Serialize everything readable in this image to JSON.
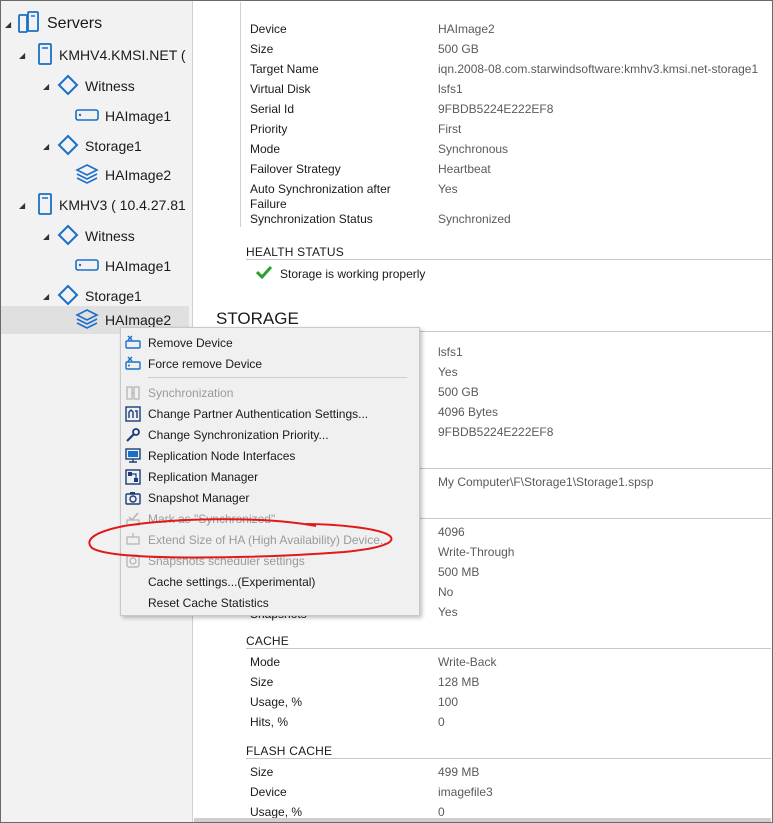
{
  "tree": {
    "root": "Servers",
    "nodes": [
      {
        "label": "KMHV4.KMSI.NET (",
        "kind": "server"
      },
      {
        "label": "Witness",
        "kind": "target"
      },
      {
        "label": "HAImage1",
        "kind": "device"
      },
      {
        "label": "Storage1",
        "kind": "target"
      },
      {
        "label": "HAImage2",
        "kind": "stack"
      },
      {
        "label": "KMHV3 ( 10.4.27.81",
        "kind": "server"
      },
      {
        "label": "Witness",
        "kind": "target"
      },
      {
        "label": "HAImage1",
        "kind": "device"
      },
      {
        "label": "Storage1",
        "kind": "target"
      },
      {
        "label": "HAImage2",
        "kind": "stack",
        "selected": true
      }
    ]
  },
  "device_props": [
    {
      "k": "Device",
      "v": "HAImage2"
    },
    {
      "k": "Size",
      "v": "500 GB"
    },
    {
      "k": "Target Name",
      "v": "iqn.2008-08.com.starwindsoftware:kmhv3.kmsi.net-storage1"
    },
    {
      "k": "Virtual Disk",
      "v": "lsfs1"
    },
    {
      "k": "Serial Id",
      "v": "9FBDB5224E222EF8"
    },
    {
      "k": "Priority",
      "v": "First"
    },
    {
      "k": "Mode",
      "v": "Synchronous"
    },
    {
      "k": "Failover Strategy",
      "v": "Heartbeat"
    },
    {
      "k": "Auto Synchronization after",
      "k2": "Failure",
      "v": "Yes"
    },
    {
      "k": "Synchronization Status",
      "v": "Synchronized"
    }
  ],
  "health": {
    "title": "HEALTH STATUS",
    "message": "Storage is working properly"
  },
  "storage": {
    "title": "STORAGE",
    "values": [
      "lsfs1",
      "Yes",
      "500 GB",
      "4096 Bytes",
      "9FBDB5224E222EF8"
    ],
    "path": "My Computer\\F\\Storage1\\Storage1.spsp",
    "values2": [
      "4096",
      "Write-Through",
      "500 MB",
      "No",
      "Yes"
    ],
    "partial_label": "Snapshots"
  },
  "cache": {
    "title": "CACHE",
    "rows": [
      {
        "k": "Mode",
        "v": "Write-Back"
      },
      {
        "k": "Size",
        "v": "128 MB"
      },
      {
        "k": "Usage, %",
        "v": "100"
      },
      {
        "k": "Hits, %",
        "v": "0"
      }
    ]
  },
  "flash_cache": {
    "title": "FLASH CACHE",
    "rows": [
      {
        "k": "Size",
        "v": "499 MB"
      },
      {
        "k": "Device",
        "v": "imagefile3"
      },
      {
        "k": "Usage, %",
        "v": "0"
      }
    ]
  },
  "menu": {
    "items": [
      {
        "label": "Remove Device",
        "icon": "remove-device-icon",
        "disabled": false
      },
      {
        "label": "Force remove Device",
        "icon": "force-remove-icon",
        "disabled": false
      },
      {
        "sep": true
      },
      {
        "label": "Synchronization",
        "icon": "sync-icon",
        "disabled": true
      },
      {
        "label": "Change Partner Authentication Settings...",
        "icon": "auth-icon",
        "disabled": false
      },
      {
        "label": "Change Synchronization Priority...",
        "icon": "wrench-icon",
        "disabled": false
      },
      {
        "label": "Replication Node Interfaces",
        "icon": "network-icon",
        "disabled": false
      },
      {
        "label": "Replication Manager",
        "icon": "replication-icon",
        "disabled": false
      },
      {
        "label": "Snapshot Manager",
        "icon": "camera-icon",
        "disabled": false
      },
      {
        "label": "Mark as \"Synchronized\"",
        "icon": "mark-sync-icon",
        "disabled": true
      },
      {
        "label": "Extend Size of HA (High Availability) Device...",
        "icon": "extend-icon",
        "disabled": true
      },
      {
        "label": "Snapshots scheduler settings",
        "icon": "scheduler-icon",
        "disabled": true
      },
      {
        "label": "Cache settings...(Experimental)",
        "icon": "",
        "disabled": false
      },
      {
        "label": "Reset Cache Statistics",
        "icon": "",
        "disabled": false
      }
    ]
  },
  "colors": {
    "accent": "#1a6fc9",
    "check": "#2ca02c",
    "annotation": "#e01a1a"
  }
}
